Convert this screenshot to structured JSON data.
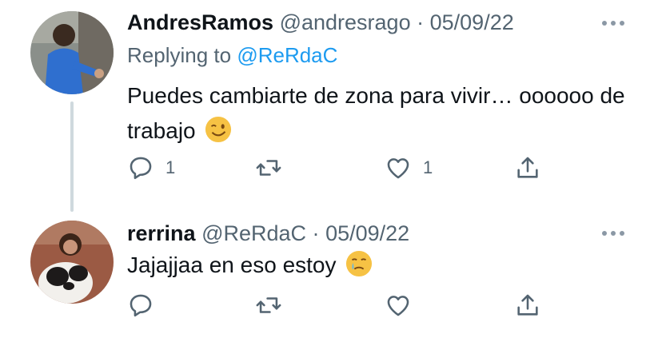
{
  "tweets": [
    {
      "display_name": "AndresRamos",
      "handle": "@andresrago",
      "separator": "·",
      "date": "05/09/22",
      "replying_label": "Replying to",
      "replying_to": "@ReRdaC",
      "text": "Puedes cambiarte de zona para vivir… oooooo de trabajo",
      "emoji": "winking-face",
      "actions": {
        "reply_count": "1",
        "retweet_count": "",
        "like_count": "1"
      }
    },
    {
      "display_name": "rerrina",
      "handle": "@ReRdaC",
      "separator": "·",
      "date": "05/09/22",
      "text": "Jajajjaa en eso estoy",
      "emoji": "face-holding-back-tears",
      "actions": {
        "reply_count": "",
        "retweet_count": "",
        "like_count": ""
      }
    }
  ],
  "colors": {
    "accent": "#1d9bf0",
    "secondary_text": "#536471",
    "thread_line": "#cfd9de"
  }
}
